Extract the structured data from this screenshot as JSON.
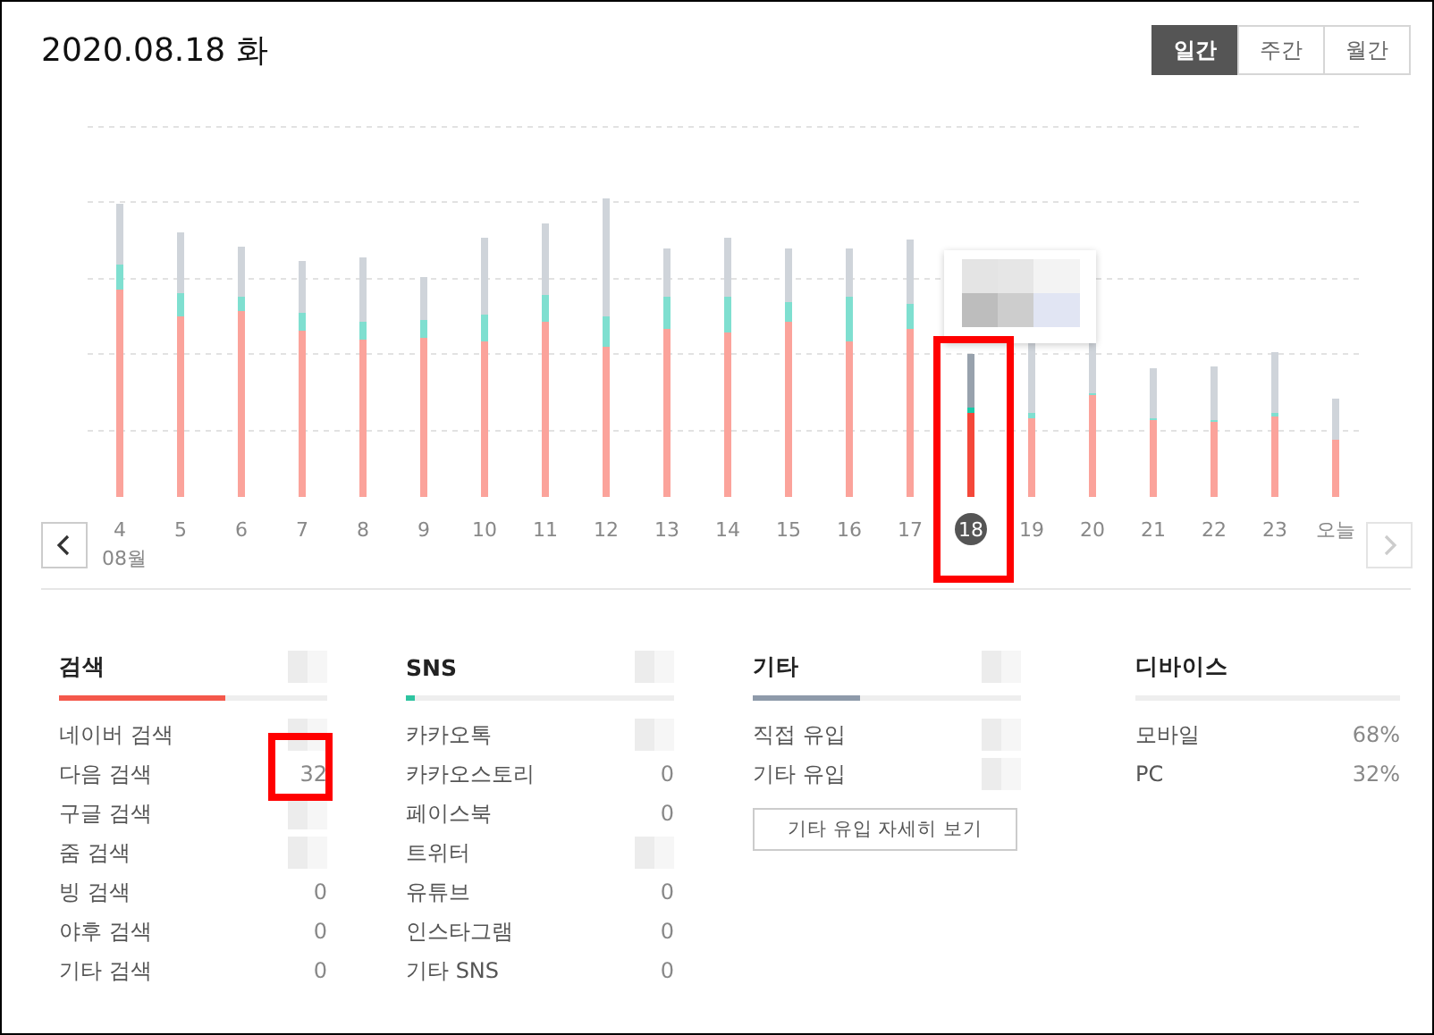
{
  "title": "2020.08.18 화",
  "periods": [
    {
      "label": "일간",
      "selected": true
    },
    {
      "label": "주간",
      "selected": false
    },
    {
      "label": "월간",
      "selected": false
    }
  ],
  "chart": {
    "month": "08월",
    "next_disabled": true,
    "days": [
      {
        "label": "4",
        "selected": false
      },
      {
        "label": "5",
        "selected": false
      },
      {
        "label": "6",
        "selected": false
      },
      {
        "label": "7",
        "selected": false
      },
      {
        "label": "8",
        "selected": false
      },
      {
        "label": "9",
        "selected": false
      },
      {
        "label": "10",
        "selected": false
      },
      {
        "label": "11",
        "selected": false
      },
      {
        "label": "12",
        "selected": false
      },
      {
        "label": "13",
        "selected": false
      },
      {
        "label": "14",
        "selected": false
      },
      {
        "label": "15",
        "selected": false
      },
      {
        "label": "16",
        "selected": false
      },
      {
        "label": "17",
        "selected": false
      },
      {
        "label": "18",
        "selected": true
      },
      {
        "label": "19",
        "selected": false
      },
      {
        "label": "20",
        "selected": false
      },
      {
        "label": "21",
        "selected": false
      },
      {
        "label": "22",
        "selected": false
      },
      {
        "label": "23",
        "selected": false
      },
      {
        "label": "오늘",
        "selected": false
      }
    ]
  },
  "sections": [
    {
      "title": "검색",
      "title_hidden": true,
      "color": "#f4584b",
      "level": 0.62,
      "rows": [
        {
          "label": "네이버 검색",
          "hidden": true
        },
        {
          "label": "다음 검색",
          "value": "32"
        },
        {
          "label": "구글 검색",
          "hidden": true
        },
        {
          "label": "줌 검색",
          "hidden": true
        },
        {
          "label": "빙 검색",
          "value": "0"
        },
        {
          "label": "야후 검색",
          "value": "0"
        },
        {
          "label": "기타 검색",
          "value": "0"
        }
      ]
    },
    {
      "title": "SNS",
      "title_hidden": true,
      "color": "#2ec4a0",
      "level": 0.03,
      "rows": [
        {
          "label": "카카오톡",
          "hidden": true
        },
        {
          "label": "카카오스토리",
          "value": "0"
        },
        {
          "label": "페이스북",
          "value": "0"
        },
        {
          "label": "트위터",
          "hidden": true
        },
        {
          "label": "유튜브",
          "value": "0"
        },
        {
          "label": "인스타그램",
          "value": "0"
        },
        {
          "label": "기타 SNS",
          "value": "0"
        }
      ]
    },
    {
      "title": "기타",
      "title_hidden": true,
      "color": "#8e9aaa",
      "level": 0.4,
      "rows": [
        {
          "label": "직접 유입",
          "hidden": true
        },
        {
          "label": "기타 유입",
          "hidden": true
        }
      ],
      "button": "기타 유입 자세히 보기"
    },
    {
      "title": "디바이스",
      "rows": [
        {
          "label": "모바일",
          "value": "68%"
        },
        {
          "label": "PC",
          "value": "32%"
        }
      ]
    }
  ]
}
